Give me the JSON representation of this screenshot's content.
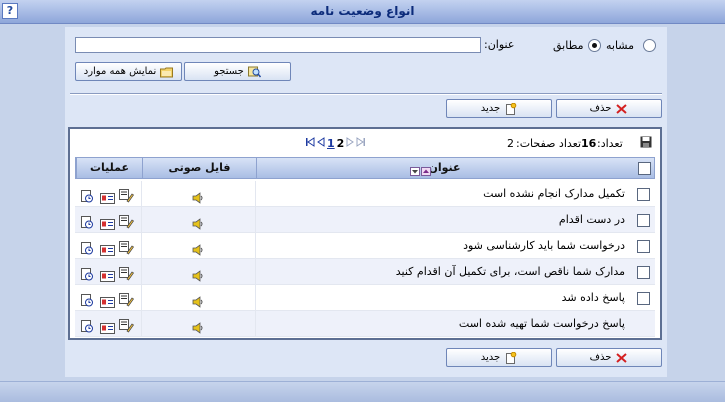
{
  "window": {
    "title": "انواع وضعیت نامه",
    "help_label": "?"
  },
  "search": {
    "title_label": "عنوان:",
    "title_value": "",
    "match_options": [
      {
        "label": "مشابه",
        "selected": false
      },
      {
        "label": "مطابق",
        "selected": true
      }
    ],
    "search_button": "جستجو",
    "show_all_button": "نمایش همه موارد"
  },
  "toolbar": {
    "delete_label": "حذف",
    "new_label": "جدید"
  },
  "grid": {
    "count_label": "تعداد:",
    "count_value": "16",
    "pages_label": "تعداد صفحات:",
    "pages_value": "2",
    "pages": [
      "1",
      "2"
    ],
    "current_page": "2",
    "columns": {
      "title": "عنوان",
      "audio": "فایل صوتی",
      "operations": "عملیات"
    },
    "rows": [
      {
        "title": "تکمیل مدارک انجام نشده است",
        "has_checkbox": true
      },
      {
        "title": "در دست اقدام",
        "has_checkbox": true
      },
      {
        "title": "درخواست شما باید کارشناسی شود",
        "has_checkbox": true
      },
      {
        "title": "مدارک شما ناقص است، برای تکمیل آن اقدام کنید",
        "has_checkbox": true
      },
      {
        "title": "پاسخ داده شد",
        "has_checkbox": true
      },
      {
        "title": "پاسخ درخواست شما تهیه شده است",
        "has_checkbox": false
      }
    ]
  },
  "colors": {
    "header_text": "#0c2b7a",
    "grid_border": "#5d6f93",
    "link": "#1d3aa0",
    "delete_icon": "#d42020",
    "speaker_icon": "#e6c21a"
  }
}
